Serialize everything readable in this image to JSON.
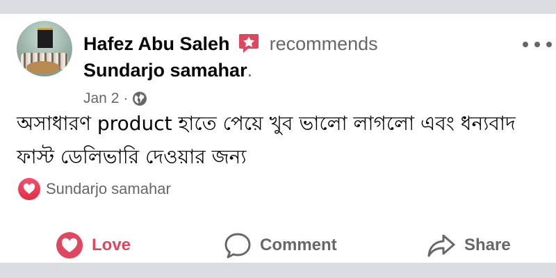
{
  "post": {
    "author": "Hafez Abu Saleh",
    "verb": "recommends",
    "page": "Sundarjo samahar",
    "page_suffix": ".",
    "date": "Jan 2",
    "date_sep": "·",
    "audience_icon": "globe-icon",
    "text": "অসাধারণ product হাতে পেয়ে খুব ভালো লাগলো এবং ধন্যবাদ ফাস্ট ডেলিভারি দেওয়ার জন্য"
  },
  "reactions": {
    "icon": "heart-icon",
    "label": "Sundarjo samahar"
  },
  "actions": {
    "love": "Love",
    "comment": "Comment",
    "share": "Share"
  },
  "colors": {
    "love": "#e0475f",
    "secondary_text": "#65676b",
    "primary_text": "#050505",
    "badge": "#e0475f"
  }
}
